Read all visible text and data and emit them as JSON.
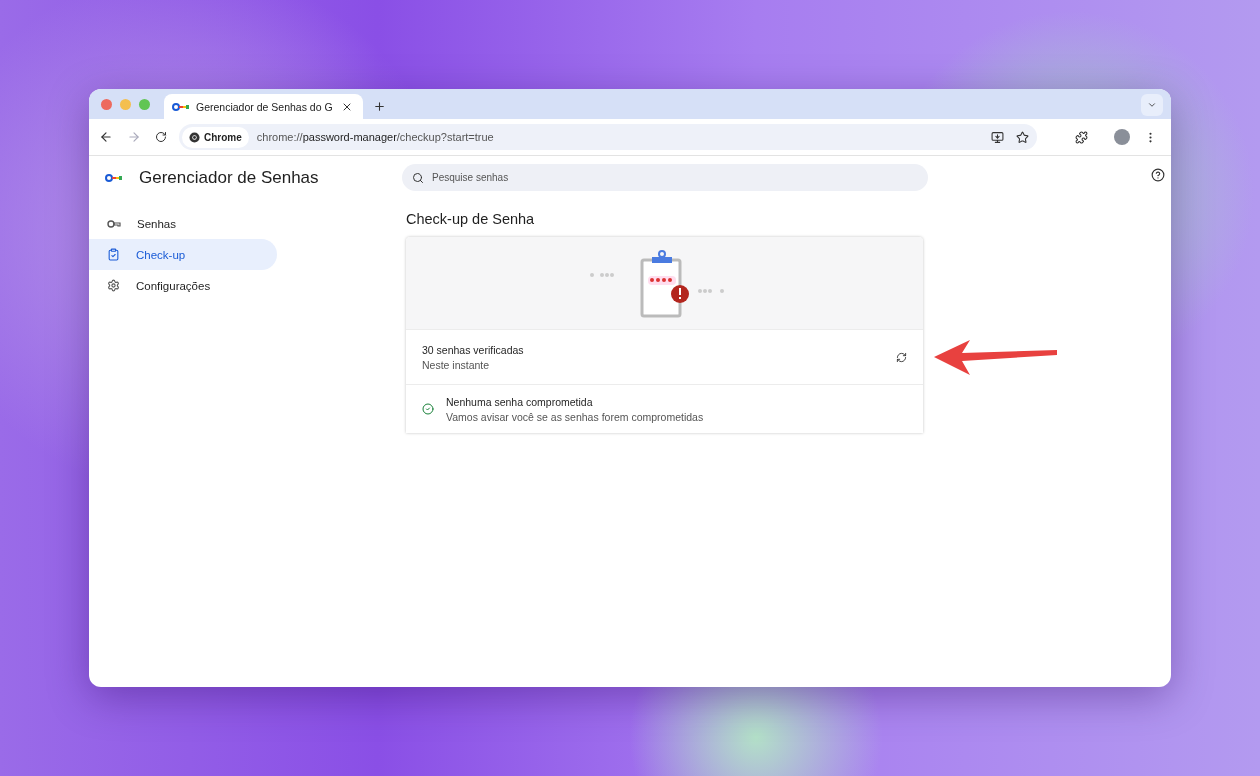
{
  "browser": {
    "tab": {
      "title": "Gerenciador de Senhas do G"
    },
    "forward_button": {
      "disabled": true
    },
    "address": {
      "chip": "Chrome",
      "url_prefix": "chrome://",
      "url_main": "password-manager",
      "url_rest": "/checkup?start=true"
    }
  },
  "sidebar": {
    "title": "Gerenciador de Senhas",
    "items": [
      {
        "label": "Senhas",
        "selected": false
      },
      {
        "label": "Check-up",
        "selected": true
      },
      {
        "label": "Configurações",
        "selected": false
      }
    ]
  },
  "search": {
    "placeholder": "Pesquise senhas"
  },
  "checkup": {
    "heading": "Check-up de Senha",
    "summary": {
      "title": "30 senhas verificadas",
      "subtitle": "Neste instante"
    },
    "result": {
      "title": "Nenhuma senha comprometida",
      "subtitle": "Vamos avisar você se as senhas forem comprometidas"
    }
  }
}
